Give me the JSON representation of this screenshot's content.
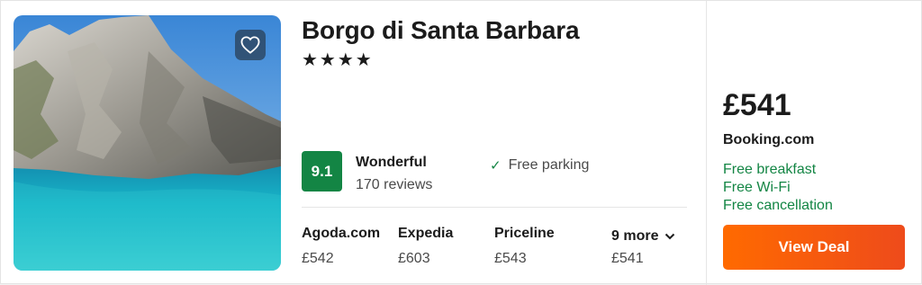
{
  "hotel": {
    "name": "Borgo di Santa Barbara",
    "stars": "★★★★",
    "star_rating": 4,
    "photo_description_icon": "coastal-cliff-photo",
    "favorite_icon": "heart-outline-icon"
  },
  "rating": {
    "score": "9.1",
    "label": "Wonderful",
    "reviews": "170 reviews"
  },
  "amenities": [
    {
      "icon": "check-icon",
      "label": "Free parking"
    }
  ],
  "providers": [
    {
      "name": "Agoda.com",
      "price": "£542"
    },
    {
      "name": "Expedia",
      "price": "£603"
    },
    {
      "name": "Priceline",
      "price": "£543"
    }
  ],
  "more": {
    "label": "9 more",
    "price": "£541",
    "icon": "chevron-down-icon"
  },
  "deal": {
    "price": "£541",
    "provider": "Booking.com",
    "perks": [
      "Free breakfast",
      "Free Wi-Fi",
      "Free cancellation"
    ],
    "button_label": "View Deal"
  },
  "colors": {
    "score_badge": "#138544",
    "perk_text": "#138544",
    "deal_button": "#ff6a00"
  }
}
